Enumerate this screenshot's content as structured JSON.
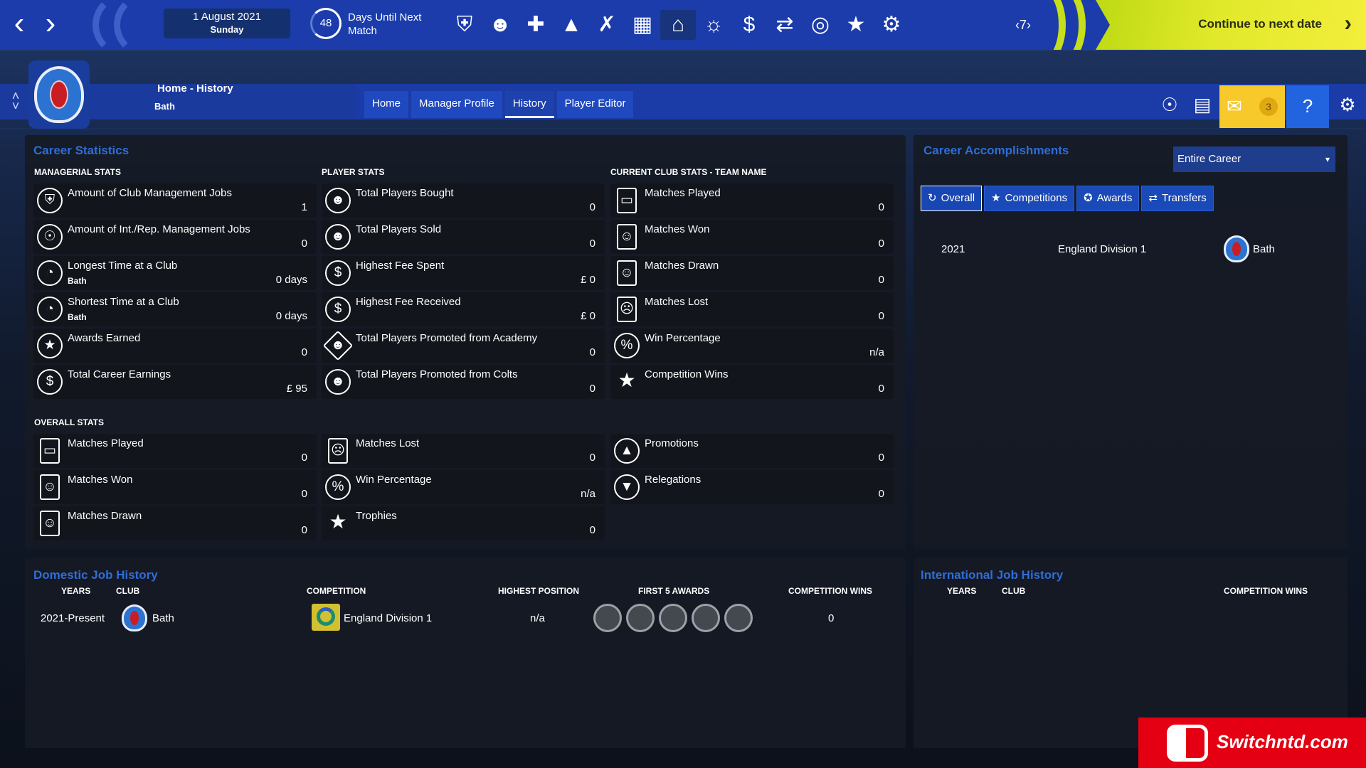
{
  "topbar": {
    "date": "1 August 2021",
    "day": "Sunday",
    "days_until_count": "48",
    "days_until_label_1": "Days Until Next",
    "days_until_label_2": "Match",
    "seven_badge": "7",
    "continue_label": "Continue to next date",
    "icons": [
      "shield-icon",
      "people-icon",
      "medical-kit-icon",
      "training-cone-icon",
      "tactics-icon",
      "calendar-icon",
      "home-icon",
      "staff-icon",
      "finance-icon",
      "transfer-icon",
      "scouting-icon",
      "trophy-icon",
      "settings-group-icon"
    ]
  },
  "header": {
    "title": "Home - History",
    "subtitle": "Bath",
    "tabs": [
      "Home",
      "Manager Profile",
      "History",
      "Player Editor"
    ],
    "active_tab": "History",
    "mail_count": "3"
  },
  "career": {
    "title": "Career Statistics",
    "managerial_head": "MANAGERIAL STATS",
    "player_head": "PLAYER STATS",
    "club_head": "CURRENT CLUB STATS - TEAM NAME",
    "overall_head": "OVERALL STATS",
    "managerial": [
      {
        "label": "Amount of Club Management Jobs",
        "sub": "",
        "value": "1",
        "icon": "shield-icon"
      },
      {
        "label": "Amount of Int./Rep. Management Jobs",
        "sub": "",
        "value": "0",
        "icon": "globe-icon"
      },
      {
        "label": "Longest Time at a Club",
        "sub": "Bath",
        "value": "0 days",
        "icon": "clock-icon"
      },
      {
        "label": "Shortest Time at a Club",
        "sub": "Bath",
        "value": "0 days",
        "icon": "clock-icon"
      },
      {
        "label": "Awards Earned",
        "sub": "",
        "value": "0",
        "icon": "medal-icon"
      },
      {
        "label": "Total Career Earnings",
        "sub": "",
        "value": "£ 95",
        "icon": "money-icon"
      }
    ],
    "player": [
      {
        "label": "Total Players Bought",
        "value": "0",
        "icon": "players-in-icon"
      },
      {
        "label": "Total Players Sold",
        "value": "0",
        "icon": "players-out-icon"
      },
      {
        "label": "Highest Fee Spent",
        "value": "£ 0",
        "icon": "money-out-icon"
      },
      {
        "label": "Highest Fee Received",
        "value": "£ 0",
        "icon": "money-in-icon"
      },
      {
        "label": "Total Players Promoted from Academy",
        "value": "0",
        "icon": "academy-icon"
      },
      {
        "label": "Total Players Promoted from Colts",
        "value": "0",
        "icon": "colts-icon"
      }
    ],
    "club": [
      {
        "label": "Matches Played",
        "value": "0",
        "icon": "match-icon"
      },
      {
        "label": "Matches Won",
        "value": "0",
        "icon": "match-won-icon"
      },
      {
        "label": "Matches Drawn",
        "value": "0",
        "icon": "match-drawn-icon"
      },
      {
        "label": "Matches Lost",
        "value": "0",
        "icon": "match-lost-icon"
      },
      {
        "label": "Win Percentage",
        "value": "n/a",
        "icon": "percent-icon"
      },
      {
        "label": "Competition Wins",
        "value": "0",
        "icon": "trophy-icon"
      }
    ],
    "overall": [
      {
        "label": "Matches Played",
        "value": "0",
        "icon": "match-icon"
      },
      {
        "label": "Matches Won",
        "value": "0",
        "icon": "match-won-icon"
      },
      {
        "label": "Matches Drawn",
        "value": "0",
        "icon": "match-drawn-icon"
      },
      {
        "label": "Matches Lost",
        "value": "0",
        "icon": "match-lost-icon"
      },
      {
        "label": "Win Percentage",
        "value": "n/a",
        "icon": "percent-icon"
      },
      {
        "label": "Trophies",
        "value": "0",
        "icon": "trophy-icon"
      },
      {
        "label": "Promotions",
        "value": "0",
        "icon": "promotion-icon"
      },
      {
        "label": "Relegations",
        "value": "0",
        "icon": "relegation-icon"
      }
    ]
  },
  "accomplishments": {
    "title": "Career Accomplishments",
    "dropdown": "Entire Career",
    "tabs": [
      "Overall",
      "Competitions",
      "Awards",
      "Transfers"
    ],
    "active_tab": "Overall",
    "row": {
      "year": "2021",
      "competition": "England Division 1",
      "club": "Bath"
    }
  },
  "domestic": {
    "title": "Domestic Job History",
    "headers": {
      "years": "YEARS",
      "club": "CLUB",
      "competition": "COMPETITION",
      "highest": "HIGHEST POSITION",
      "awards": "FIRST 5 AWARDS",
      "wins": "COMPETITION WINS"
    },
    "row": {
      "years": "2021-Present",
      "club": "Bath",
      "competition": "England Division 1",
      "highest": "n/a",
      "wins": "0"
    }
  },
  "international": {
    "title": "International Job History",
    "headers": {
      "years": "YEARS",
      "club": "CLUB",
      "wins": "COMPETITION WINS"
    }
  },
  "watermark": "Switchntd.com"
}
